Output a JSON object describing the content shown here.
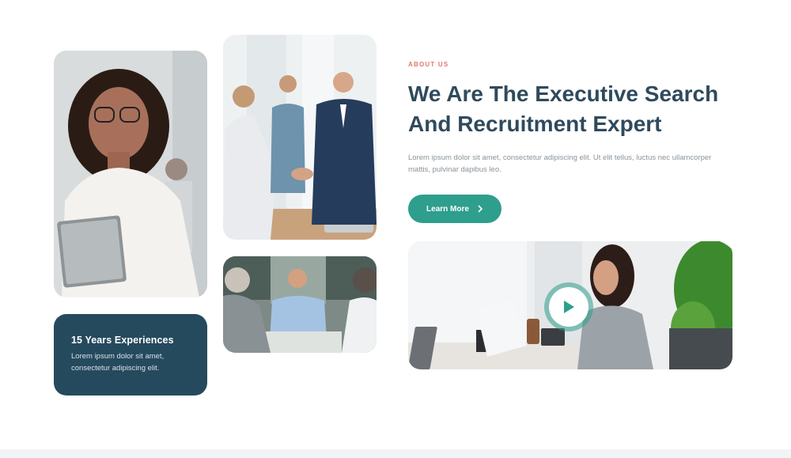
{
  "about": {
    "eyebrow": "ABOUT US",
    "headline_line1": "We Are The Executive Search",
    "headline_line2": "And Recruitment Expert",
    "description": "Lorem ipsum dolor sit amet, consectetur adipiscing elit. Ut elit tellus, luctus nec ullamcorper mattis, pulvinar dapibus leo.",
    "button_label": "Learn More",
    "button_icon": "chevron-right-icon"
  },
  "experience": {
    "title": "15 Years Experiences",
    "text": "Lorem ipsum dolor sit amet, consectetur adipiscing elit."
  },
  "video": {
    "play_icon": "play-icon"
  },
  "colors": {
    "accent": "#2e9e8d",
    "eyebrow": "#e0796d",
    "heading": "#2f4a5c",
    "card": "#254a5e",
    "body_text": "#8a939a"
  }
}
